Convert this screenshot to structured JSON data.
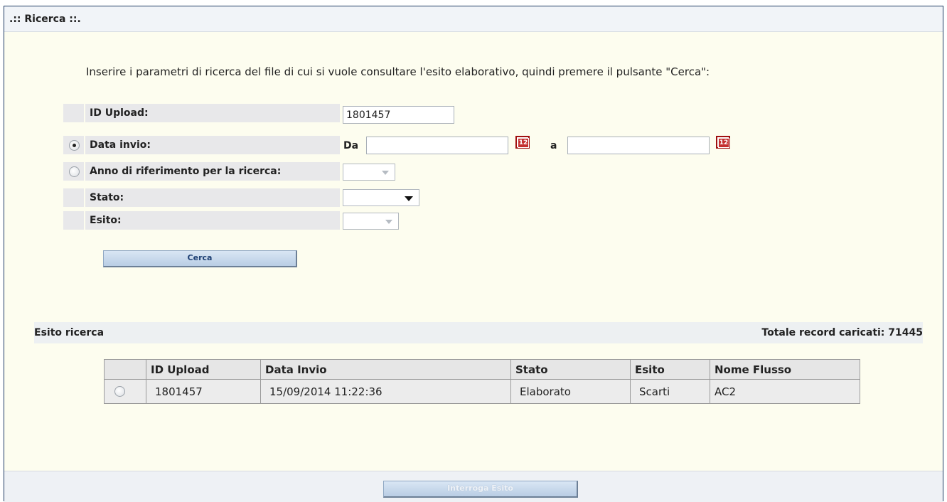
{
  "title": ".:: Ricerca ::.",
  "instructions": "Inserire i parametri di ricerca del file di cui si vuole consultare l'esito elaborativo, quindi premere il pulsante \"Cerca\":",
  "form": {
    "id_upload_label": "ID Upload:",
    "id_upload_value": "1801457",
    "data_invio_label": "Data invio:",
    "da_label": "Da",
    "a_label": "a",
    "da_value": "",
    "a_value": "",
    "anno_label": "Anno di riferimento per la ricerca:",
    "stato_label": "Stato:",
    "esito_label": "Esito:",
    "selected_radio": "data_invio"
  },
  "buttons": {
    "cerca": "Cerca",
    "interroga": "Interroga Esito"
  },
  "results": {
    "title": "Esito ricerca",
    "total": "Totale record caricati: 71445",
    "columns": [
      "",
      "ID Upload",
      "Data Invio",
      "Stato",
      "Esito",
      "Nome Flusso"
    ],
    "rows": [
      {
        "id": "1801457",
        "data": "15/09/2014 11:22:36",
        "stato": "Elaborato",
        "esito": "Scarti",
        "nome": "AC2"
      }
    ]
  },
  "icons": {
    "calendar": "calendar-icon",
    "dropdown": "chevron-down-icon"
  },
  "colors": {
    "frame_border": "#1f3b63",
    "background": "#fdfdef",
    "button_text": "#1d3f73"
  }
}
